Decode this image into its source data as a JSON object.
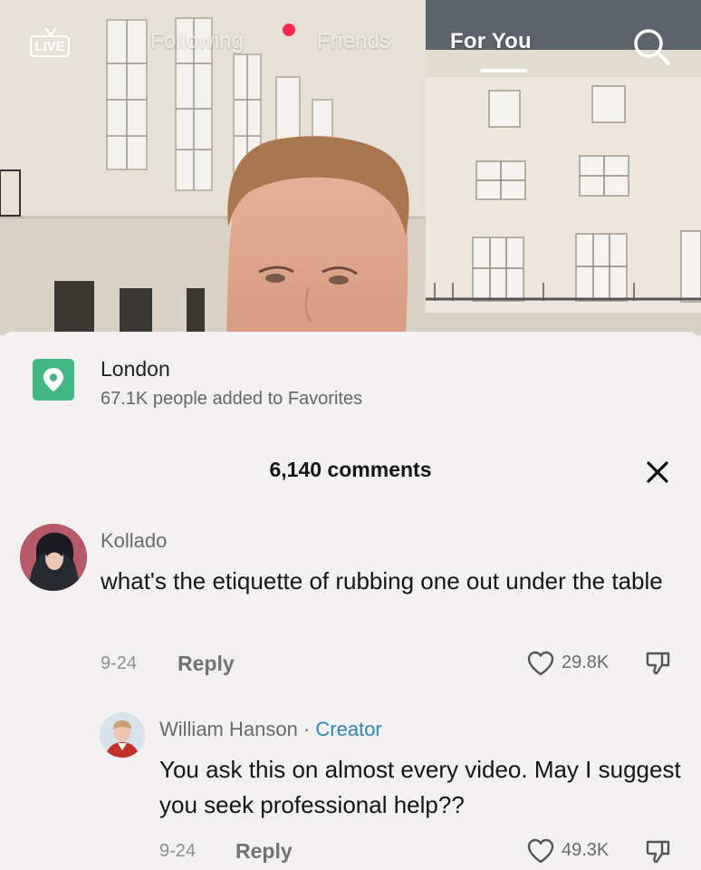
{
  "top_nav": {
    "live_label": "LIVE",
    "tabs": [
      {
        "label": "Following",
        "active": false,
        "has_notification_dot": true
      },
      {
        "label": "Friends",
        "active": false
      },
      {
        "label": "For You",
        "active": true
      }
    ],
    "search_icon": "search-icon"
  },
  "location": {
    "icon": "location-pin-icon",
    "name": "London",
    "subtitle": "67.1K people added to Favorites"
  },
  "comments": {
    "header": "6,140 comments",
    "close_icon": "close-icon",
    "items": [
      {
        "username": "Kollado",
        "text": "what's the etiquette of rubbing one out under the table",
        "date": "9-24",
        "reply_label": "Reply",
        "likes": "29.8K"
      },
      {
        "username": "William Hanson",
        "separator": " · ",
        "badge": "Creator",
        "text": "You ask this on almost every video. May I suggest you seek professional help??",
        "date": "9-24",
        "reply_label": "Reply",
        "likes": "49.3K"
      }
    ]
  },
  "colors": {
    "panel_bg": "#f2f0f1",
    "location_green": "#41b884",
    "creator_blue": "#2e88b4",
    "live_dot_red": "#ff2b55"
  }
}
